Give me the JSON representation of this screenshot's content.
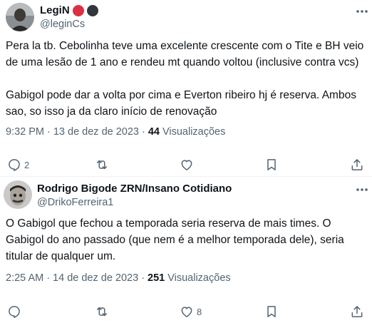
{
  "tweet1": {
    "display_name": "LegiN",
    "badges": [
      {
        "icon": "red-circle-icon",
        "color": "#dd2e44"
      },
      {
        "icon": "black-circle-icon",
        "color": "#31373d"
      }
    ],
    "handle": "@leginCs",
    "paragraph1": "Pera la tb. Cebolinha teve uma excelente crescente com o Tite e BH veio\nde uma lesão de 1 ano e rendeu mt quando voltou (inclusive contra vcs)",
    "paragraph2": "Gabigol pode dar a volta por cima e Everton ribeiro hj é reserva. Ambos\nsao, so isso ja da claro início de renovação",
    "time": "9:32 PM",
    "date": "13 de dez de 2023",
    "views_count": "44",
    "views_label": "Visualizações",
    "reply_count": "2"
  },
  "tweet2": {
    "display_name": "Rodrigo Bigode ZRN/Insano Cotidiano",
    "handle": "@DrikoFerreira1",
    "text": "O Gabigol que fechou a temporada seria reserva de mais times. O\nGabigol do ano passado (que nem é a melhor temporada dele), seria\ntitular de qualquer um.",
    "time": "2:25 AM",
    "date": "14 de dez de 2023",
    "views_count": "251",
    "views_label": "Visualizações",
    "like_count": "8"
  },
  "separator": "·",
  "colors": {
    "text": "#0f1419",
    "secondary": "#536471",
    "divider": "#eff3f4"
  }
}
